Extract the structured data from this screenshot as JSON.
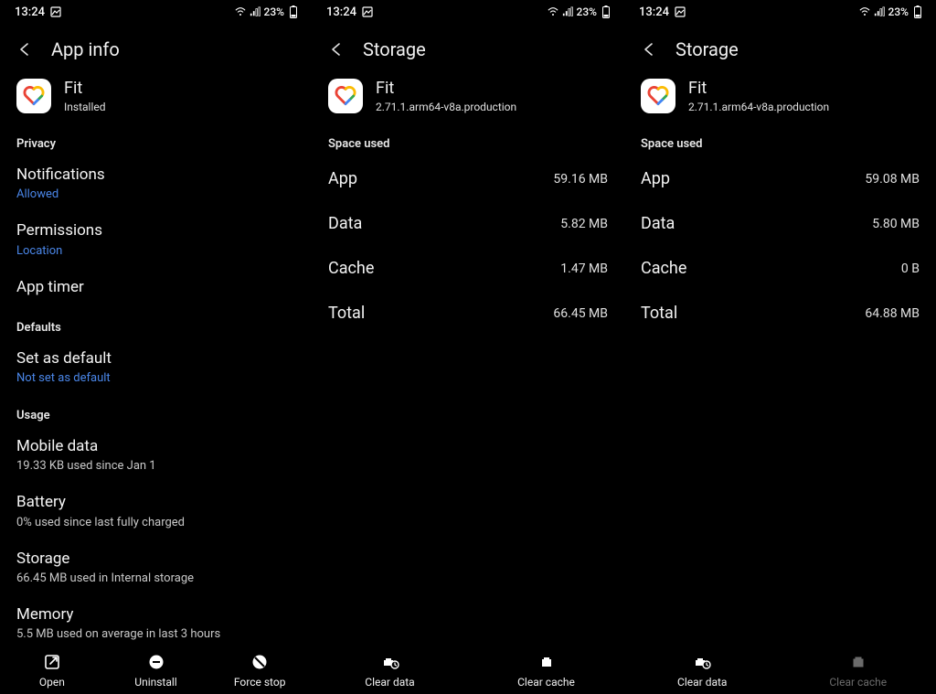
{
  "status": {
    "time": "13:24",
    "battery_pct": "23%"
  },
  "icons": {
    "image": "image-icon",
    "wifi": "wifi-icon",
    "signal": "signal-icon",
    "battery": "battery-icon"
  },
  "app": {
    "name": "Fit",
    "installed_label": "Installed",
    "version": "2.71.1.arm64-v8a.production"
  },
  "screen1": {
    "title": "App info",
    "sections": {
      "privacy": {
        "head": "Privacy",
        "notifications": {
          "label": "Notifications",
          "value": "Allowed"
        },
        "permissions": {
          "label": "Permissions",
          "value": "Location"
        },
        "app_timer": {
          "label": "App timer"
        }
      },
      "defaults": {
        "head": "Defaults",
        "set_default": {
          "label": "Set as default",
          "value": "Not set as default"
        }
      },
      "usage": {
        "head": "Usage",
        "mobile_data": {
          "label": "Mobile data",
          "value": "19.33 KB used since Jan 1"
        },
        "battery": {
          "label": "Battery",
          "value": "0% used since last fully charged"
        },
        "storage": {
          "label": "Storage",
          "value": "66.45 MB used in Internal storage"
        },
        "memory": {
          "label": "Memory",
          "value": "5.5 MB used on average in last 3 hours"
        }
      }
    },
    "bottom": {
      "open": "Open",
      "uninstall": "Uninstall",
      "force_stop": "Force stop"
    }
  },
  "screen2": {
    "title": "Storage",
    "space_used_head": "Space used",
    "rows": {
      "app": {
        "k": "App",
        "v": "59.16 MB"
      },
      "data": {
        "k": "Data",
        "v": "5.82 MB"
      },
      "cache": {
        "k": "Cache",
        "v": "1.47 MB"
      },
      "total": {
        "k": "Total",
        "v": "66.45 MB"
      }
    },
    "bottom": {
      "clear_data": "Clear data",
      "clear_cache": "Clear cache"
    }
  },
  "screen3": {
    "title": "Storage",
    "space_used_head": "Space used",
    "rows": {
      "app": {
        "k": "App",
        "v": "59.08 MB"
      },
      "data": {
        "k": "Data",
        "v": "5.80 MB"
      },
      "cache": {
        "k": "Cache",
        "v": "0 B"
      },
      "total": {
        "k": "Total",
        "v": "64.88 MB"
      }
    },
    "bottom": {
      "clear_data": "Clear data",
      "clear_cache": "Clear cache"
    }
  }
}
